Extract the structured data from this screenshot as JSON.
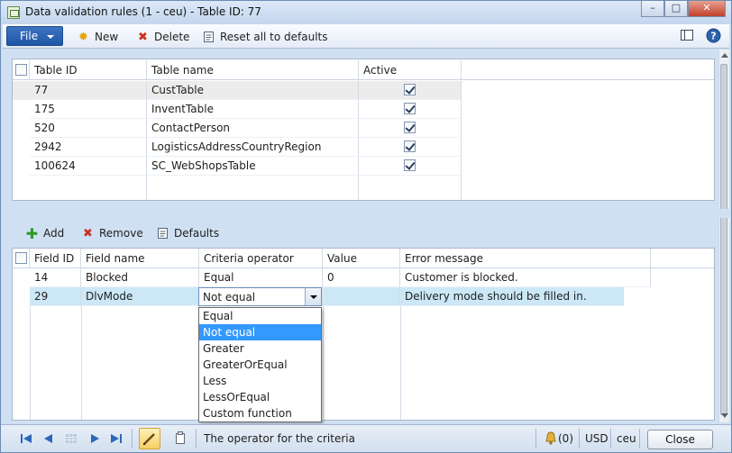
{
  "window": {
    "title": "Data validation rules (1 - ceu) - Table ID: 77"
  },
  "toolbar": {
    "file_label": "File",
    "new_label": "New",
    "delete_label": "Delete",
    "reset_label": "Reset all to defaults"
  },
  "tables_grid": {
    "columns": [
      "Table ID",
      "Table name",
      "Active"
    ],
    "rows": [
      {
        "id": "77",
        "name": "CustTable",
        "active": true
      },
      {
        "id": "175",
        "name": "InventTable",
        "active": true
      },
      {
        "id": "520",
        "name": "ContactPerson",
        "active": true
      },
      {
        "id": "2942",
        "name": "LogisticsAddressCountryRegion",
        "active": true
      },
      {
        "id": "100624",
        "name": "SC_WebShopsTable",
        "active": true
      }
    ]
  },
  "fields_toolbar": {
    "add_label": "Add",
    "remove_label": "Remove",
    "defaults_label": "Defaults"
  },
  "fields_grid": {
    "columns": [
      "Field ID",
      "Field name",
      "Criteria operator",
      "Value",
      "Error message"
    ],
    "rows": [
      {
        "field_id": "14",
        "field_name": "Blocked",
        "operator": "Equal",
        "value": "0",
        "error": "Customer is blocked."
      },
      {
        "field_id": "29",
        "field_name": "DlvMode",
        "operator": "Not equal",
        "value": "",
        "error": "Delivery mode should be filled in."
      }
    ]
  },
  "operator_dropdown": {
    "selected": "Not equal",
    "options": [
      "Equal",
      "Not equal",
      "Greater",
      "GreaterOrEqual",
      "Less",
      "LessOrEqual",
      "Custom function"
    ]
  },
  "statusbar": {
    "help_text": "The operator for the criteria",
    "notifications": "(0)",
    "currency": "USD",
    "company": "ceu",
    "close_label": "Close"
  },
  "colors": {
    "accent": "#1f56a6",
    "selection": "#3399ff",
    "row_highlight": "#cce8f7"
  }
}
